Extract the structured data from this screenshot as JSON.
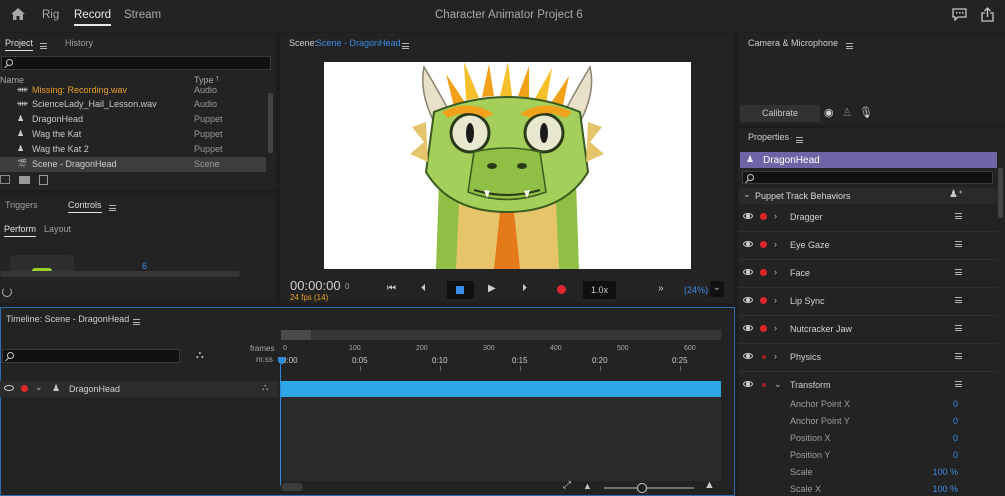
{
  "app": {
    "nav": [
      "Rig",
      "Record",
      "Stream"
    ],
    "active_nav": "Record",
    "title": "Character Animator Project 6"
  },
  "project_panel": {
    "tabs": [
      "Project",
      "History"
    ],
    "col_name": "Name",
    "col_type": "Type",
    "items": [
      {
        "name": "Missing: Recording.wav",
        "type": "Audio",
        "icon": "audio-icon",
        "missing": true
      },
      {
        "name": "ScienceLady_Hail_Lesson.wav",
        "type": "Audio",
        "icon": "audio-icon"
      },
      {
        "name": "DragonHead",
        "type": "Puppet",
        "icon": "puppet-icon"
      },
      {
        "name": "Wag the Kat",
        "type": "Puppet",
        "icon": "puppet-icon"
      },
      {
        "name": "Wag the Kat 2",
        "type": "Puppet",
        "icon": "puppet-icon"
      },
      {
        "name": "Scene - DragonHead",
        "type": "Scene",
        "icon": "scene-icon",
        "selected": true
      }
    ]
  },
  "controls_panel": {
    "tabs": [
      "Triggers",
      "Controls"
    ],
    "subtabs": [
      "Perform",
      "Layout"
    ],
    "badge": "6"
  },
  "scene_panel": {
    "label": "Scene:",
    "scene_name": "Scene - DragonHead",
    "timecode": "00:00:00",
    "frame": "0",
    "fps": "24 fps (14)",
    "speed": "1.0x",
    "zoom": "(24%)"
  },
  "camera_panel": {
    "title": "Camera & Microphone",
    "calibrate": "Calibrate"
  },
  "properties_panel": {
    "title": "Properties",
    "puppet": "DragonHead",
    "section": "Puppet Track Behaviors",
    "behaviors": [
      {
        "name": "Dragger",
        "armed": true
      },
      {
        "name": "Eye Gaze",
        "armed": true
      },
      {
        "name": "Face",
        "armed": true
      },
      {
        "name": "Lip Sync",
        "armed": true
      },
      {
        "name": "Nutcracker Jaw",
        "armed": true
      },
      {
        "name": "Physics",
        "armed": false
      },
      {
        "name": "Transform",
        "armed": false,
        "expanded": true
      }
    ],
    "params": [
      {
        "name": "Anchor Point X",
        "value": "0"
      },
      {
        "name": "Anchor Point Y",
        "value": "0"
      },
      {
        "name": "Position X",
        "value": "0"
      },
      {
        "name": "Position Y",
        "value": "0"
      },
      {
        "name": "Scale",
        "value": "100 %"
      },
      {
        "name": "Scale X",
        "value": "100 %"
      }
    ]
  },
  "timeline": {
    "title": "Timeline: Scene - DragonHead",
    "frames_label": "frames",
    "mss_label": "m:ss",
    "frame_ticks": [
      "0",
      "100",
      "200",
      "300",
      "400",
      "500",
      "600"
    ],
    "time_ticks": [
      "0:00",
      "0:05",
      "0:10",
      "0:15",
      "0:20",
      "0:25"
    ],
    "track_name": "DragonHead"
  },
  "colors": {
    "accent": "#3b8ee8",
    "record": "#e0262c",
    "track_bar": "#2fa6e6",
    "missing": "#e8a020",
    "puppet_bar": "#6e64a6"
  }
}
